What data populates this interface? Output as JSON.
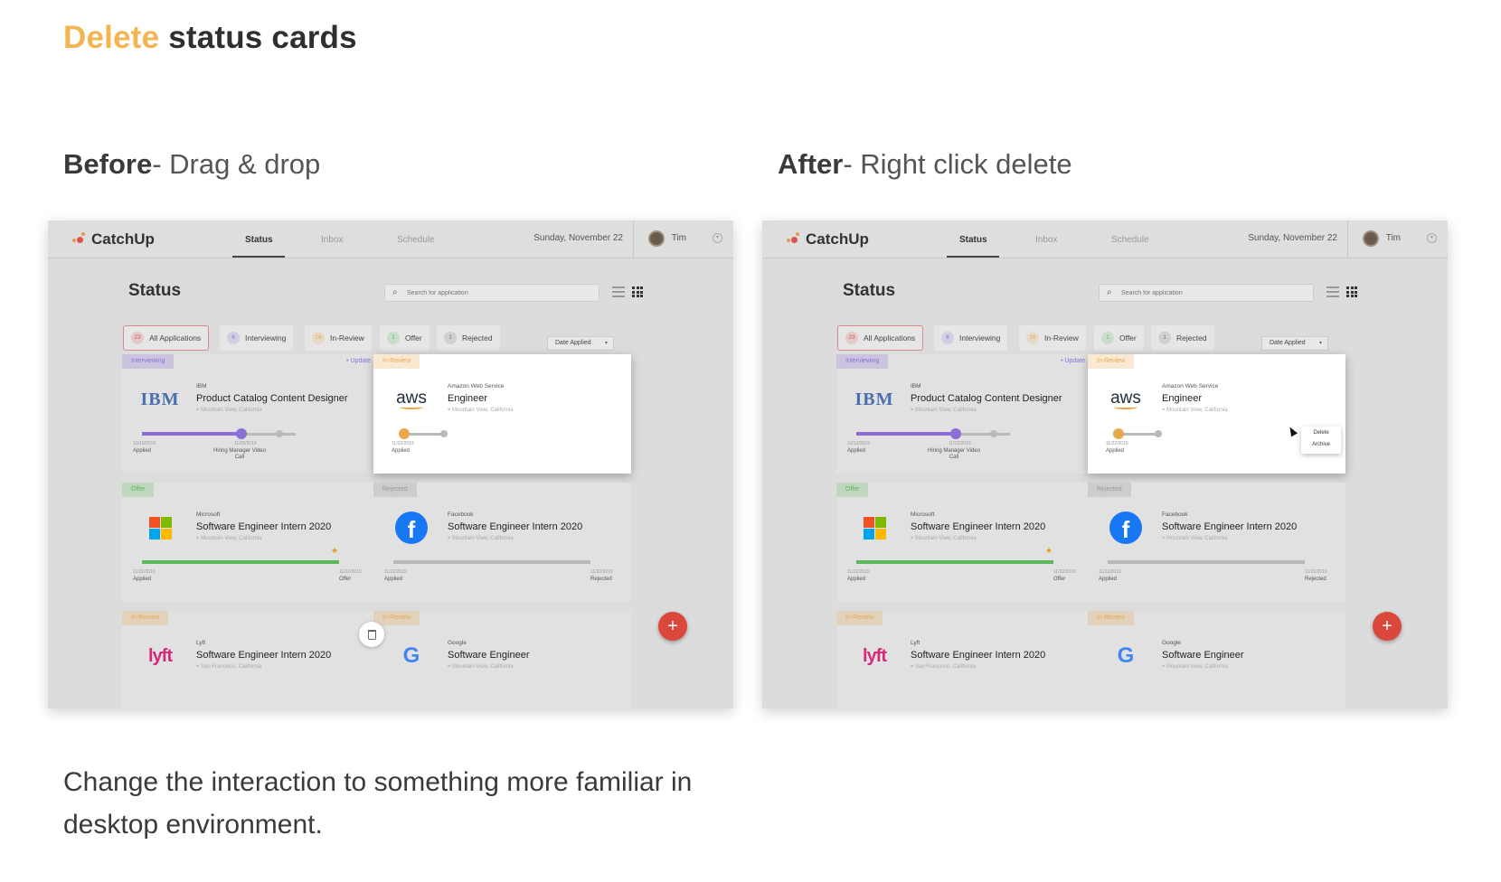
{
  "page": {
    "title_accent": "Delete",
    "title_rest": " status cards",
    "before_bold": "Before",
    "before_rest": "- Drag & drop",
    "after_bold": "After",
    "after_rest": "- Right click delete",
    "description": "Change the interaction to something more familiar in desktop environment."
  },
  "app": {
    "logo": "CatchUp",
    "nav": [
      "Status",
      "Inbox",
      "Schedule"
    ],
    "date": "Sunday, November 22",
    "user": "Tim",
    "heading": "Status",
    "search_placeholder": "Search for application",
    "sort_label": "Date Applied",
    "filters": [
      {
        "count": "23",
        "label": "All Applications",
        "color": "#d9534f"
      },
      {
        "count": "6",
        "label": "Interviewing",
        "color": "#8b6fd6"
      },
      {
        "count": "16",
        "label": "In-Review",
        "color": "#e8a94e"
      },
      {
        "count": "1",
        "label": "Offer",
        "color": "#5cb85c"
      },
      {
        "count": "1",
        "label": "Rejected",
        "color": "#777777"
      }
    ],
    "cards": [
      {
        "status": "Interviewing",
        "update": "• Update",
        "company": "IBM",
        "role": "Product Catalog Content Designer",
        "location": "Mountain View, California",
        "tick1": "Applied",
        "tick2": "Hiring Manager Video Call",
        "date1": "10/10/2019",
        "date2": "11/22/2019"
      },
      {
        "status": "In-Review",
        "company": "Amazon Web Service",
        "role": "Engineer",
        "location": "Mountain View, California",
        "tick1": "Applied",
        "date1": "11/22/2019"
      },
      {
        "status": "Offer",
        "company": "Microsoft",
        "role": "Software Engineer Intern 2020",
        "location": "Mountain View, California",
        "tick1": "Applied",
        "tick2": "Offer",
        "date1": "11/22/2019",
        "date2": "11/22/2019"
      },
      {
        "status": "Rejected",
        "company": "Facebook",
        "role": "Software Engineer Intern 2020",
        "location": "Mountain View, California",
        "tick1": "Applied",
        "tick2": "Rejected",
        "date1": "11/22/2019",
        "date2": "11/22/2019"
      },
      {
        "status": "In-Review",
        "company": "Lyft",
        "role": "Software Engineer Intern 2020",
        "location": "San Francisco, California"
      },
      {
        "status": "In-Review",
        "company": "Google",
        "role": "Software Engineer",
        "location": "Mountain View, California"
      }
    ],
    "context_menu": [
      "Delete",
      "Archive"
    ],
    "logos": {
      "ibm": "IBM",
      "aws": "aws",
      "lyft": "lyft",
      "google": "G",
      "facebook": "f"
    },
    "colors": {
      "interviewing": "#8b6fd6",
      "review": "#e8a94e",
      "offer": "#5cb85c",
      "reject": "#b9b9b9",
      "accent": "#d9483b"
    }
  }
}
